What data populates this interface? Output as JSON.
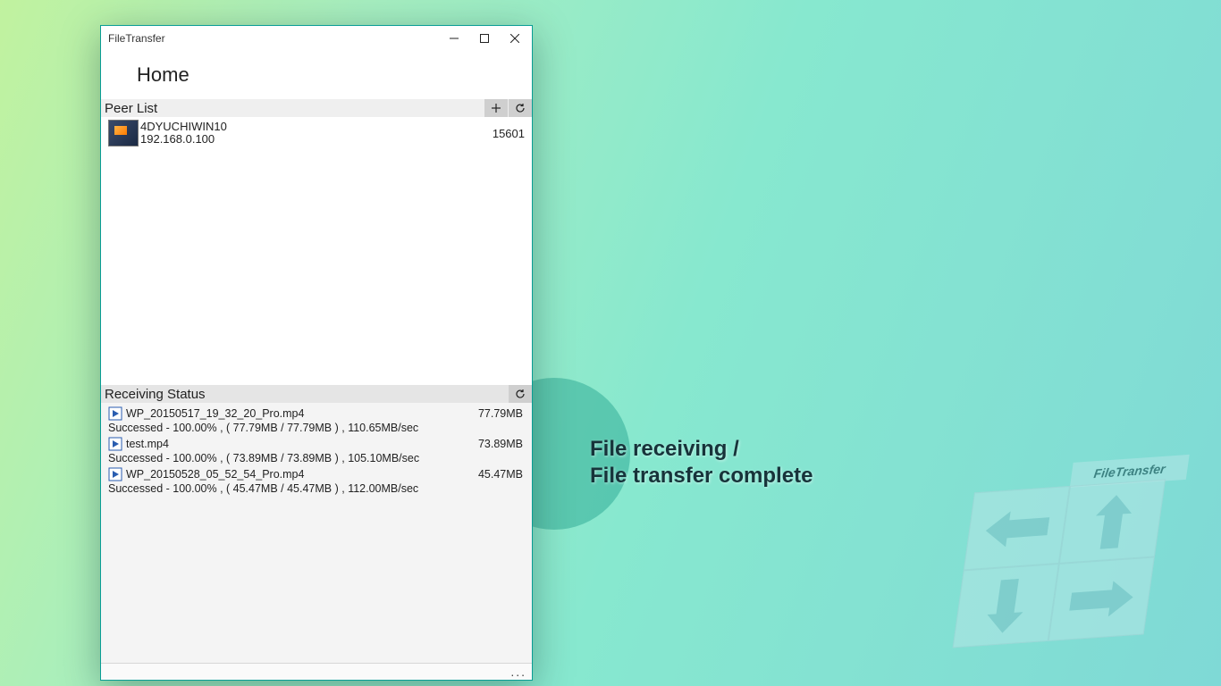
{
  "promo": {
    "line1": "File receiving /",
    "line2": "File transfer complete"
  },
  "logo_label": "FileTransfer",
  "window": {
    "title": "FileTransfer",
    "page_title": "Home",
    "peer_section_label": "Peer List",
    "recv_section_label": "Receiving Status",
    "status_ellipsis": "..."
  },
  "peers": [
    {
      "name": "4DYUCHIWIN10",
      "ip": "192.168.0.100",
      "port": "15601"
    }
  ],
  "files": [
    {
      "name": "WP_20150517_19_32_20_Pro.mp4",
      "size": "77.79MB",
      "status": "Successed - 100.00% , ( 77.79MB / 77.79MB ) , 110.65MB/sec"
    },
    {
      "name": "test.mp4",
      "size": "73.89MB",
      "status": "Successed - 100.00% , ( 73.89MB / 73.89MB ) , 105.10MB/sec"
    },
    {
      "name": "WP_20150528_05_52_54_Pro.mp4",
      "size": "45.47MB",
      "status": "Successed - 100.00% , ( 45.47MB / 45.47MB ) , 112.00MB/sec"
    }
  ]
}
